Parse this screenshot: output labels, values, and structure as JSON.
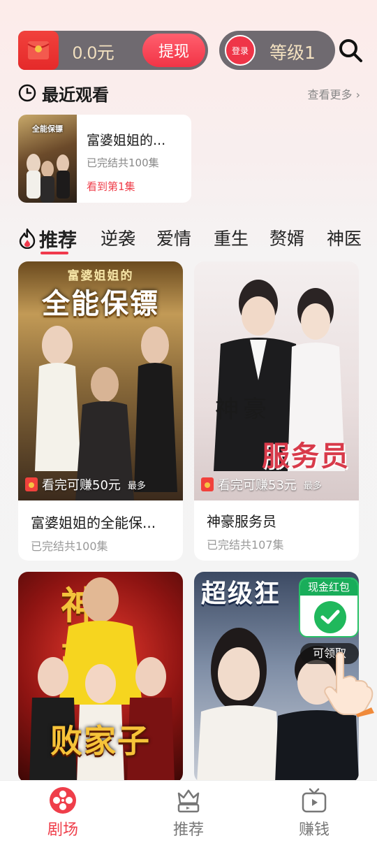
{
  "header": {
    "wallet_amount": "0.0元",
    "withdraw_label": "提现",
    "login_label": "登录",
    "level_label": "等级1"
  },
  "recent": {
    "title": "最近观看",
    "see_more": "查看更多",
    "item": {
      "poster_text": "全能保镖",
      "name": "富婆姐姐的...",
      "episodes": "已完结共100集",
      "progress": "看到第1集"
    }
  },
  "tabs": [
    "推荐",
    "逆袭",
    "爱情",
    "重生",
    "赘婿",
    "神医"
  ],
  "dramas": [
    {
      "poster_title": "全能保镖",
      "poster_subtitle": "富婆姐姐的",
      "reward": "看完可赚50元",
      "reward_suffix": "最多",
      "name": "富婆姐姐的全能保...",
      "episodes": "已完结共100集"
    },
    {
      "poster_title": "服务员",
      "poster_subtitle": "神豪",
      "reward": "看完可赚53元",
      "reward_suffix": "最多",
      "name": "神豪服务员",
      "episodes": "已完结共107集"
    },
    {
      "poster_title": "败家子",
      "poster_subtitle": "神 豪"
    },
    {
      "poster_title": "超级狂"
    }
  ],
  "cash_widget": {
    "label": "现金红包",
    "claim": "可领取"
  },
  "bottom_nav": [
    {
      "label": "剧场",
      "active": true
    },
    {
      "label": "推荐",
      "active": false
    },
    {
      "label": "赚钱",
      "active": false
    }
  ],
  "colors": {
    "accent": "#ef3e4a",
    "pill_bg": "#6f6a70",
    "gold_text": "#f3e1c0",
    "wechat_green": "#19ad5a"
  }
}
